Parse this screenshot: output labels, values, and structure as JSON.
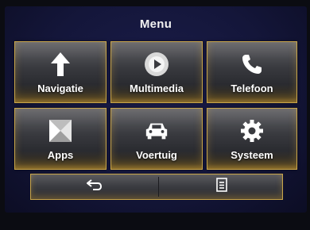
{
  "header": {
    "title": "Menu"
  },
  "tiles": [
    {
      "label": "Navigatie",
      "icon": "navigation-arrow-icon"
    },
    {
      "label": "Multimedia",
      "icon": "play-icon"
    },
    {
      "label": "Telefoon",
      "icon": "phone-icon"
    },
    {
      "label": "Apps",
      "icon": "apps-icon"
    },
    {
      "label": "Voertuig",
      "icon": "car-icon"
    },
    {
      "label": "Systeem",
      "icon": "gear-icon"
    }
  ],
  "bottom_bar": {
    "back_icon": "back-arrow-icon",
    "list_icon": "list-icon"
  },
  "colors": {
    "border_gold": "#c9a64a",
    "background": "#14163a",
    "text": "#ffffff"
  }
}
